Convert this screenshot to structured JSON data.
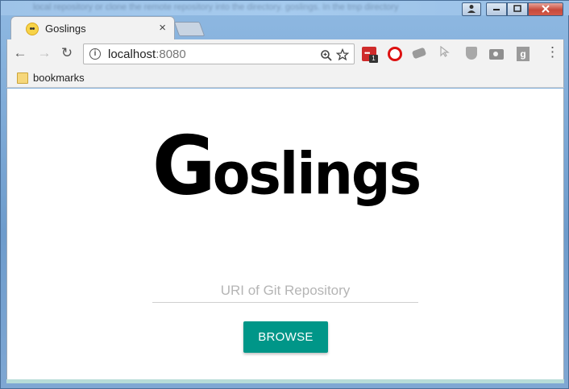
{
  "window": {
    "background_text": "local repository or clone the remote repository into the directory. goslings. In the tmp directory"
  },
  "tab": {
    "title": "Goslings",
    "close": "×"
  },
  "nav": {
    "back": "←",
    "forward": "→",
    "reload": "↻",
    "menu": "⋮"
  },
  "omnibox": {
    "info": "i",
    "host": "localhost",
    "port": ":8080"
  },
  "extensions": {
    "badge_count": "1",
    "g_label": "g"
  },
  "bookmarks": {
    "folder_label": "bookmarks"
  },
  "page": {
    "logo_initial": "G",
    "logo_rest": "oslings",
    "uri_placeholder": "URI of Git Repository",
    "uri_value": "",
    "browse_label": "BROWSE"
  },
  "colors": {
    "accent": "#009688"
  }
}
